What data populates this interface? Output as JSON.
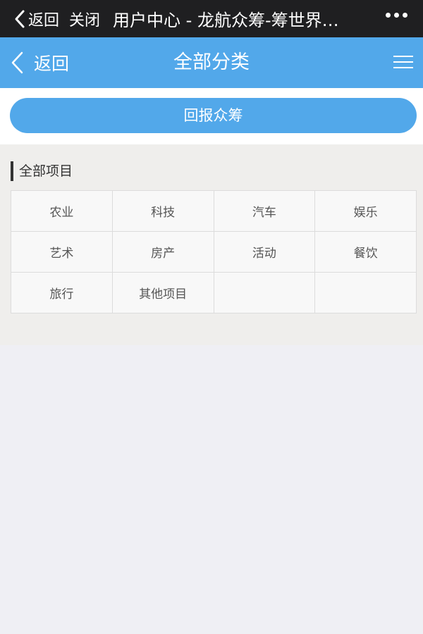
{
  "wechat_bar": {
    "back_label": "返回",
    "close_label": "关闭",
    "title": "用户中心 - 龙航众筹-筹世界…"
  },
  "header": {
    "back_label": "返回",
    "title": "全部分类"
  },
  "return_button": {
    "label": "回报众筹"
  },
  "categories": {
    "section_title": "全部项目",
    "items": [
      "农业",
      "科技",
      "汽车",
      "娱乐",
      "艺术",
      "房产",
      "活动",
      "餐饮",
      "旅行",
      "其他项目"
    ]
  },
  "colors": {
    "accent": "#52a8ea",
    "wechat_bar": "#1f1f21",
    "page_bg": "#efeff4"
  }
}
